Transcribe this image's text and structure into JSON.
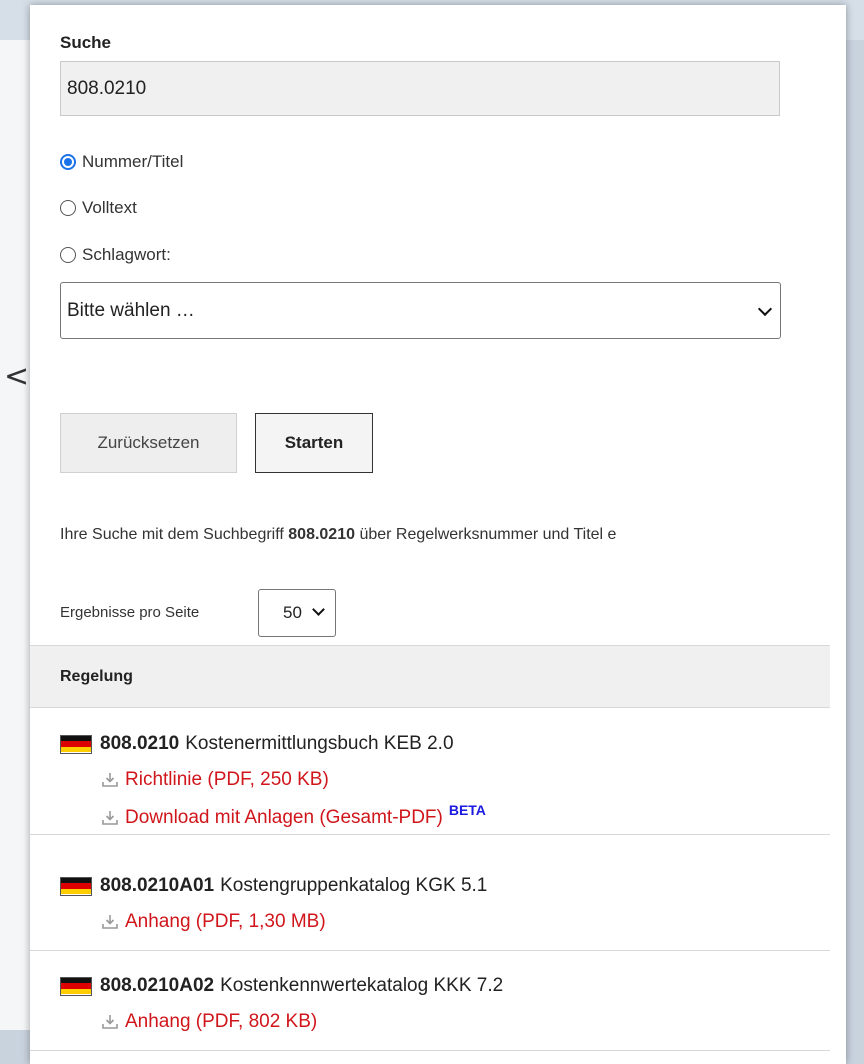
{
  "back_glyph": "<",
  "search": {
    "label": "Suche",
    "value": "808.0210"
  },
  "search_mode": {
    "options": [
      "Nummer/Titel",
      "Volltext",
      "Schlagwort:"
    ],
    "selected": "Nummer/Titel"
  },
  "keyword_select": {
    "selected": "Bitte wählen …"
  },
  "buttons": {
    "reset": "Zurücksetzen",
    "start": "Starten"
  },
  "info": {
    "prefix": "Ihre Suche mit dem Suchbegriff ",
    "term": "808.0210",
    "suffix": " über Regelwerksnummer und Titel e"
  },
  "per_page": {
    "label": "Ergebnisse pro Seite",
    "value": "50"
  },
  "table": {
    "header": "Regelung",
    "rows": [
      {
        "number": "808.0210",
        "title": "Kostenermittlungsbuch KEB 2.0",
        "links": [
          {
            "text": "Richtlinie (PDF, 250 KB)"
          },
          {
            "text": "Download mit Anlagen (Gesamt-PDF)",
            "badge": "BETA"
          }
        ]
      },
      {
        "number": "808.0210A01",
        "title": "Kostengruppenkatalog KGK 5.1",
        "links": [
          {
            "text": "Anhang (PDF, 1,30 MB)"
          }
        ]
      },
      {
        "number": "808.0210A02",
        "title": "Kostenkennwertekatalog KKK 7.2",
        "links": [
          {
            "text": "Anhang (PDF, 802 KB)"
          }
        ]
      }
    ]
  },
  "colors": {
    "link": "#d0161b",
    "beta": "#1a1ae0",
    "radio_accent": "#1a73e8"
  },
  "icons": {
    "flag": "germany-flag-icon",
    "download": "download-icon",
    "chevron": "chevron-down-icon"
  }
}
